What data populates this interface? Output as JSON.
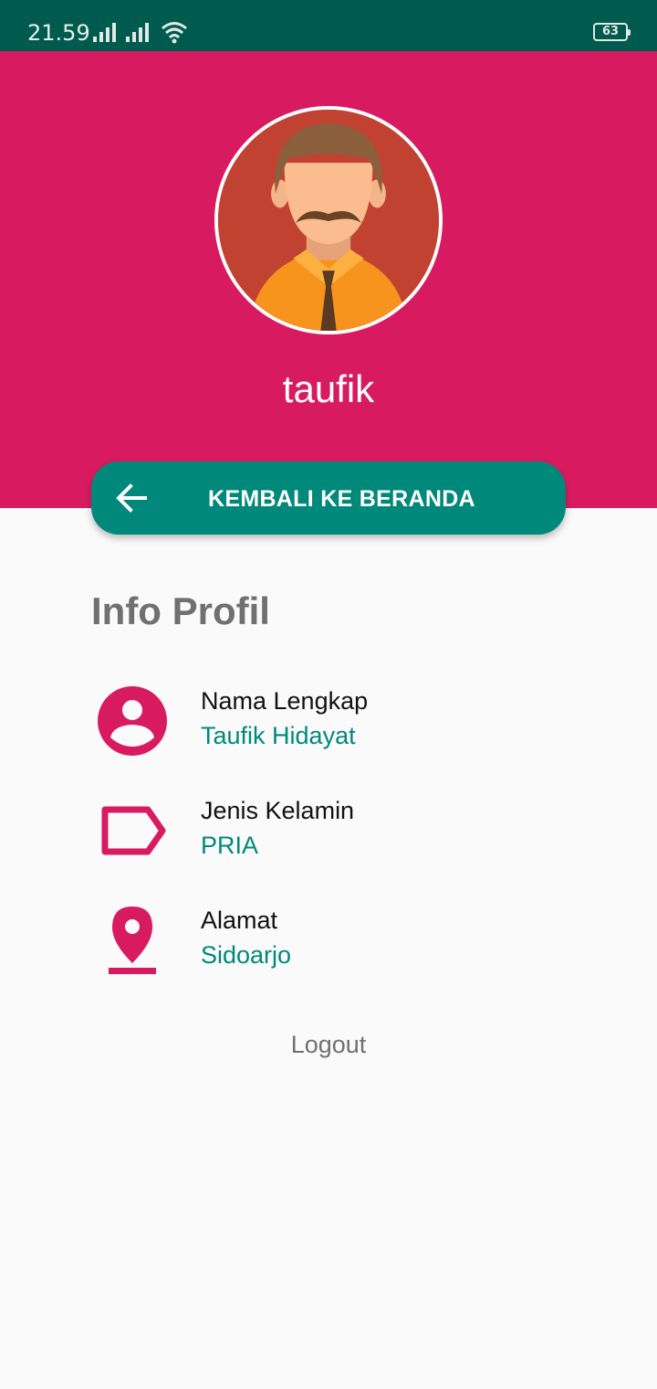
{
  "status_bar": {
    "time": "21.59",
    "battery": "63"
  },
  "profile": {
    "username": "taufik"
  },
  "back_button": {
    "label": "KEMBALI KE BERANDA"
  },
  "info": {
    "title": "Info Profil",
    "rows": [
      {
        "label": "Nama Lengkap",
        "value": "Taufik Hidayat",
        "icon": "person-icon"
      },
      {
        "label": "Jenis Kelamin",
        "value": "PRIA",
        "icon": "tag-icon"
      },
      {
        "label": "Alamat",
        "value": "Sidoarjo",
        "icon": "location-pin-icon"
      }
    ]
  },
  "logout": {
    "label": "Logout"
  },
  "colors": {
    "primary": "#d81b60",
    "accent": "#00897b",
    "statusbar": "#005a4e"
  }
}
